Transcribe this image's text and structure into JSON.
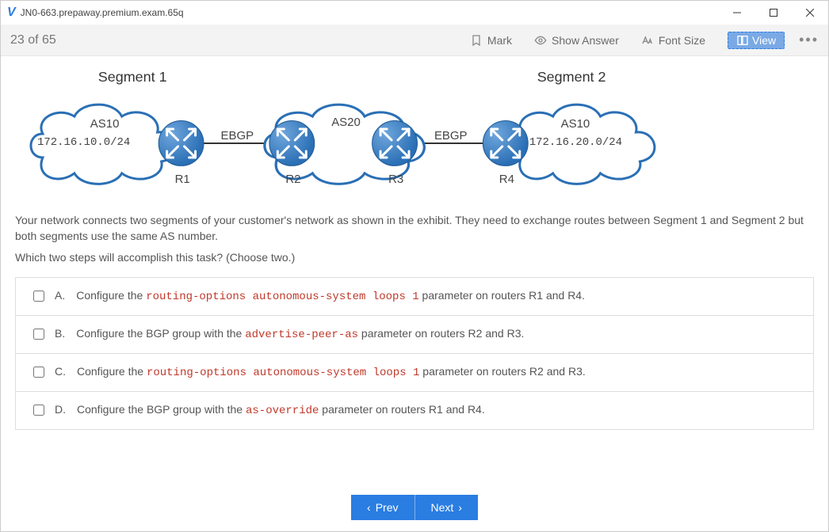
{
  "window": {
    "title": "JN0-663.prepaway.premium.exam.65q"
  },
  "toolbar": {
    "counter": "23 of 65",
    "mark": "Mark",
    "show_answer": "Show Answer",
    "font_size": "Font Size",
    "view": "View"
  },
  "diagram": {
    "segment1_title": "Segment 1",
    "segment2_title": "Segment 2",
    "cloud1_as": "AS10",
    "cloud1_subnet": "172.16.10.0/24",
    "cloud2_as": "AS20",
    "cloud3_as": "AS10",
    "cloud3_subnet": "172.16.20.0/24",
    "ebgp1": "EBGP",
    "ebgp2": "EBGP",
    "r1": "R1",
    "r2": "R2",
    "r3": "R3",
    "r4": "R4"
  },
  "question": {
    "para1": "Your network connects two segments of your customer's network as shown in the exhibit. They need to exchange routes between Segment 1 and Segment 2 but both segments use the same AS number.",
    "para2": "Which two steps will accomplish this task? (Choose two.)"
  },
  "options": {
    "a": {
      "letter": "A.",
      "pre": "Configure the ",
      "code": "routing-options autonomous-system loops 1",
      "post": " parameter on routers R1 and R4."
    },
    "b": {
      "letter": "B.",
      "pre": "Configure the BGP group with the ",
      "code": "advertise-peer-as",
      "post": " parameter on routers R2 and R3."
    },
    "c": {
      "letter": "C.",
      "pre": "Configure the ",
      "code": "routing-options autonomous-system loops 1",
      "post": " parameter on routers R2 and R3."
    },
    "d": {
      "letter": "D.",
      "pre": "Configure the BGP group with the ",
      "code": "as-override",
      "post": " parameter on routers R1 and R4."
    }
  },
  "footer": {
    "prev": "Prev",
    "next": "Next"
  }
}
